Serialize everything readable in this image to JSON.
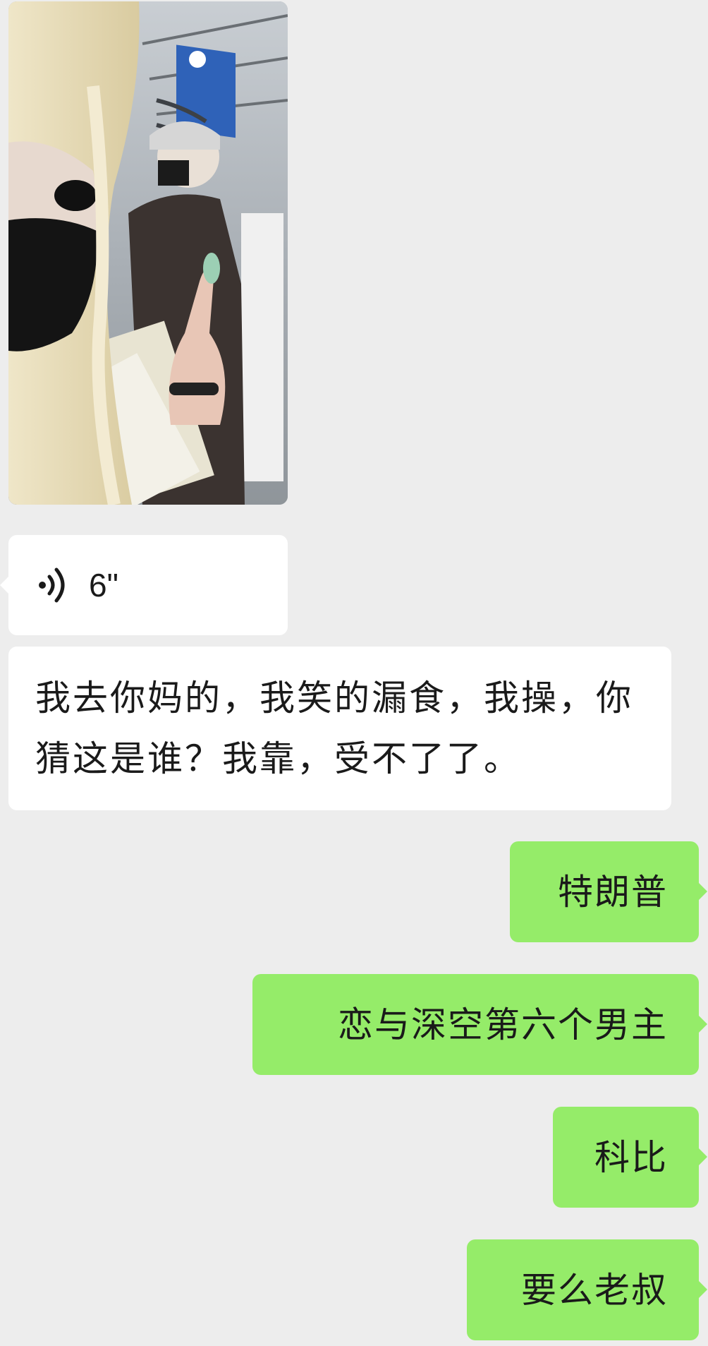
{
  "chat": {
    "photo": {
      "description_icon": "photo-icon"
    },
    "voice": {
      "icon": "voice-wave-icon",
      "duration": "6\""
    },
    "incoming_text": "我去你妈的，我笑的漏食，我操，你猜这是谁？我靠，受不了了。",
    "outgoing": [
      {
        "text": "特朗普"
      },
      {
        "text": "恋与深空第六个男主"
      },
      {
        "text": "科比"
      },
      {
        "text": "要么老叔"
      }
    ]
  },
  "colors": {
    "background": "#ededed",
    "incoming_bubble": "#ffffff",
    "outgoing_bubble": "#95ec69"
  }
}
